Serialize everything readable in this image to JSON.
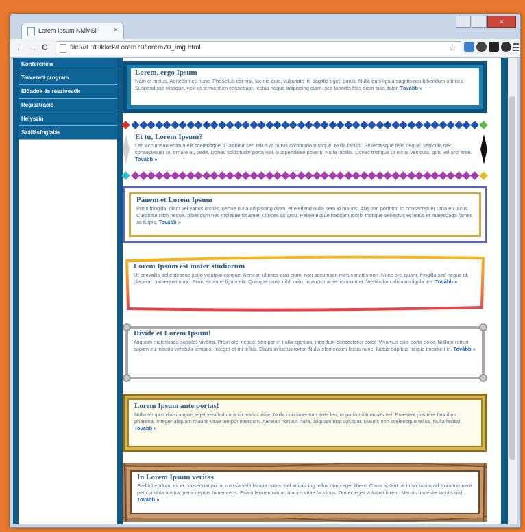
{
  "browser": {
    "tab_title": "Lorem Ipsum NMMSI",
    "tab_close": "×",
    "close_glyph": "×",
    "url": "file:///E:/Cikkek/Lorem70/lorem70_img.html",
    "back_glyph": "←",
    "forward_glyph": "→",
    "reload_glyph": "C",
    "star_glyph": "☆"
  },
  "sidebar": {
    "items": [
      {
        "label": "Konferencia"
      },
      {
        "label": "Tervezett program"
      },
      {
        "label": "Előadók és résztvevők"
      },
      {
        "label": "Regisztráció"
      },
      {
        "label": "Helyszín"
      },
      {
        "label": "Szállásfoglalás"
      }
    ]
  },
  "boxes": [
    {
      "title": "Lorem, ergo Ipsum",
      "text": "Nam et metus. Aenean nec nunc. Phasellus est nisi, lacinia quis, vulputate in, sagittis eget, purus. Nulla quis ligula sagittis nisi bibendum ultrices. Suspendisse tristique, velit et fermentum consequat, lectus neque adipiscing diam, sed lobortis felis diam quis dolor.",
      "more": "Tovább »"
    },
    {
      "title": "Et tu, Lorem Ipsum?",
      "text": "Leo accumsan enim a elit scelerisque. Curabitur sed tellus at purus commodo tristique. Nulla facilisi. Pellentesque felis neque, vehicula nec, consectetuer ut, ornare at, pede. Donec sollicitudin porta nisl. Suspendisse potenti. Nulla facilisi. Donec tristique ut elit at vehicula, quis vel orci ante.",
      "more": "Tovább »"
    },
    {
      "title": "Panem et Lorem Ipsum",
      "text": "Proin fringilla, diam vel varius iaculis, neque nulla adipiscing diam, et eleifend nulla sem id mauris. Aliquam porttitor. In consectetuer urna eu lacus. Curabitur nibh neque, bibendum nec molestie sit amet, ultrices ac arcu. Pellentesque habitant morbi tristique senectus et netus et malesuada fames ac turpis.",
      "more": "Tovább »"
    },
    {
      "title": "Lorem Ipsum est mater studiorum",
      "text": "Ut convallis pellentesque justo volutpat congue. Aenean ultrices erat enim, non accumsan metus mattis non. Nunc orci quam, fringilla sed neque id, placerat consequat nunc. Proin sit amet ligula elit. Quisque porta nibh odio, in auctor ante tincidunt et. Vestibulum aliquam ligula leo.",
      "more": "Tovább »"
    },
    {
      "title": "Divide et Lorem Ipsum!",
      "text": "Aliquam malesuada sodales viverra. Proin orci neque, semper in nulla egestas, interdum consectetur dolor. Vivamus quis porta dolor. Nullam rutrum sapien eu mauris vehicula tempus. Integer et mi tellus. Etiam in luctus tortor. Nulla elementum lacus nunc, luctus dapibus neque tincidunt in.",
      "more": "Tovább »"
    },
    {
      "title": "Lorem Ipsum ante portas!",
      "text": "Nulla tempus diam augue, eget vestibulum arcu mattis vitae. Nulla condimentum ante leo, ut porta nibh iaculis vel. Praesent posuere faucibus pharetra. Integer aliquam mauris vitae tempor interdum. Aenean non elit nulla, aliquam erat volutpat. Mauris non scelerisque tellus. Nulla facilisi.",
      "more": "Tovább »"
    },
    {
      "title": "In Lorem Ipsum veritas",
      "text": "Sed bibendum, mi et consequat porta, massa velit lacinia purus, vel adipiscing tellus diam eget libero. Class aptent taciti sociosqu ad litora torquent per conubia nostra, per inceptos himenaeos. Etiam fermentum ac mauris vitae faucibus. Donec eget volutpat lorem. Mauris molestie iaculis nisl.",
      "more": "Tovább »"
    }
  ],
  "colors": {
    "page_bg": "#e8782f",
    "menu_bg": "#0e6496",
    "frame_blue": "#0b4f7c",
    "diamond_blue": "#2153b0",
    "diamond_purple": "#a83bb0",
    "corner_red": "#e0302a",
    "corner_green": "#58b848",
    "corner_cyan": "#2fbfd0",
    "corner_yellow": "#e0c02a"
  },
  "icons": [
    "back-arrow-icon",
    "forward-arrow-icon",
    "reload-icon",
    "page-icon",
    "star-icon",
    "extension-icons",
    "menu-icon"
  ]
}
